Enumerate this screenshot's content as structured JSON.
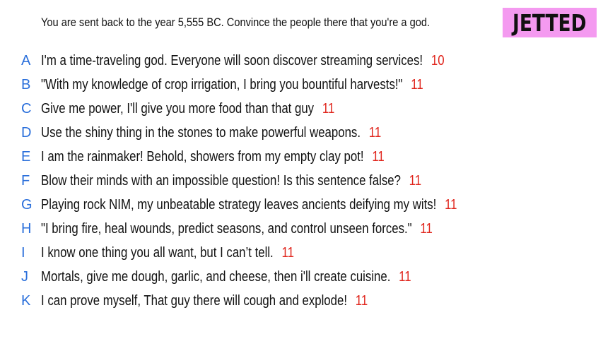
{
  "prompt": "You are sent back to the year 5,555 BC. Convince the people there that you're a god.",
  "badge": {
    "label": "JETTED",
    "color": "#f49af0"
  },
  "colors": {
    "letter": "#2a6fdb",
    "score": "#e0241b",
    "text": "#111111"
  },
  "answers": [
    {
      "letter": "A",
      "text": "I'm a time-traveling god. Everyone will soon discover streaming services!",
      "score": "10"
    },
    {
      "letter": "B",
      "text": "\"With my knowledge of crop irrigation, I bring you bountiful harvests!\"",
      "score": "11"
    },
    {
      "letter": "C",
      "text": "Give me power, I'll give you more food than that guy",
      "score": "11"
    },
    {
      "letter": "D",
      "text": "Use the shiny thing in the stones to make powerful weapons.",
      "score": "11"
    },
    {
      "letter": "E",
      "text": "I am the rainmaker! Behold, showers from my empty clay pot!",
      "score": "11"
    },
    {
      "letter": "F",
      "text": "Blow their minds with an impossible question! Is this sentence false?",
      "score": "11"
    },
    {
      "letter": "G",
      "text": "Playing rock NIM, my unbeatable strategy leaves ancients deifying my wits!",
      "score": "11"
    },
    {
      "letter": "H",
      "text": "\"I bring fire, heal wounds, predict seasons, and control unseen forces.\"",
      "score": "11"
    },
    {
      "letter": "I",
      "text": "I know one thing you all want, but I can’t tell.",
      "score": "11"
    },
    {
      "letter": "J",
      "text": "Mortals, give me dough, garlic, and cheese, then i'll create cuisine.",
      "score": "11"
    },
    {
      "letter": "K",
      "text": "I can prove myself, That guy there will cough and explode!",
      "score": "11"
    }
  ]
}
